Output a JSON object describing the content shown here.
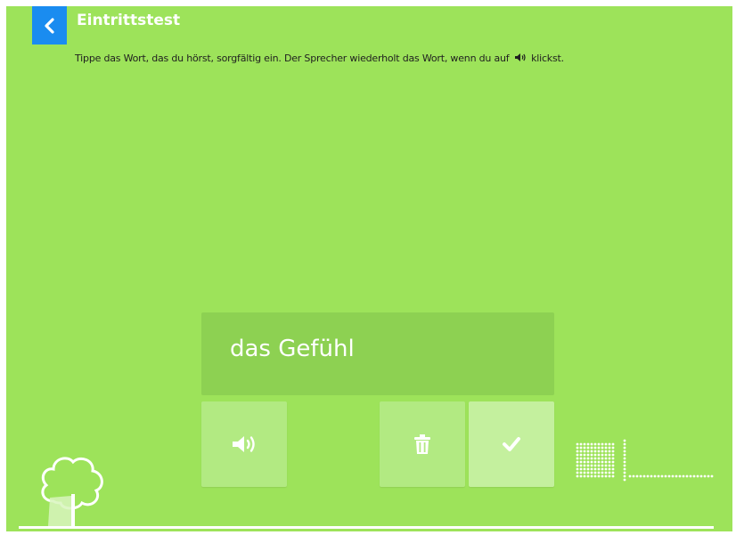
{
  "header": {
    "title": "Eintrittstest",
    "back_icon": "chevron-left-icon",
    "accent_color": "#1a8cf0"
  },
  "instruction": {
    "text_before": "Tippe das Wort, das du hörst, sorgfältig ein. Der Sprecher wiederholt das Wort, wenn du auf",
    "inline_icon": "speaker-icon",
    "text_after": "klickst."
  },
  "answer": {
    "value": "das Gefühl"
  },
  "buttons": {
    "speaker_icon": "speaker-icon",
    "delete_icon": "trash-icon",
    "confirm_icon": "checkmark-icon"
  },
  "colors": {
    "background": "#9de35a",
    "answer_box": "#8dd152",
    "tile": "#b2ea82",
    "confirm_tile": "#c4f09e"
  },
  "decor": {
    "tree_icon": "tree-icon",
    "progress_icon": "dot-progress-icon"
  }
}
